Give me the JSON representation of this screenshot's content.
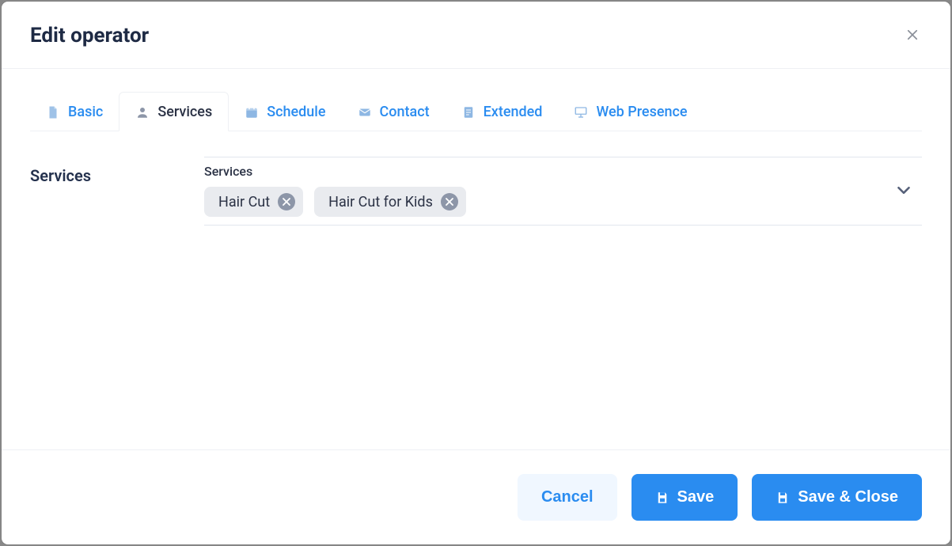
{
  "modal": {
    "title": "Edit operator"
  },
  "tabs": [
    {
      "id": "basic",
      "label": "Basic",
      "icon": "file",
      "active": false
    },
    {
      "id": "services",
      "label": "Services",
      "icon": "user",
      "active": true
    },
    {
      "id": "schedule",
      "label": "Schedule",
      "icon": "calendar",
      "active": false
    },
    {
      "id": "contact",
      "label": "Contact",
      "icon": "envelope",
      "active": false
    },
    {
      "id": "extended",
      "label": "Extended",
      "icon": "document",
      "active": false
    },
    {
      "id": "webpresence",
      "label": "Web Presence",
      "icon": "presentation",
      "active": false
    }
  ],
  "form": {
    "section_label": "Services",
    "field_label": "Services",
    "selected_services": [
      "Hair Cut",
      "Hair Cut for Kids"
    ]
  },
  "footer": {
    "cancel": "Cancel",
    "save": "Save",
    "save_close": "Save & Close"
  }
}
